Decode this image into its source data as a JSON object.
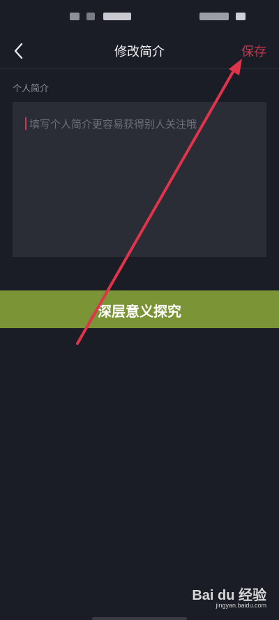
{
  "header": {
    "back_icon": "chevron-left-icon",
    "title": "修改简介",
    "save_label": "保存",
    "save_color": "#c8354c"
  },
  "bio": {
    "section_label": "个人简介",
    "placeholder": "填写个人简介更容易获得别人关注哦"
  },
  "overlay": {
    "banner_text": "深层意义探究",
    "banner_color": "#7a9436",
    "arrow_color": "#e0344a"
  },
  "watermark": {
    "main": "Bai du 经验",
    "sub": "jingyan.baidu.com"
  }
}
